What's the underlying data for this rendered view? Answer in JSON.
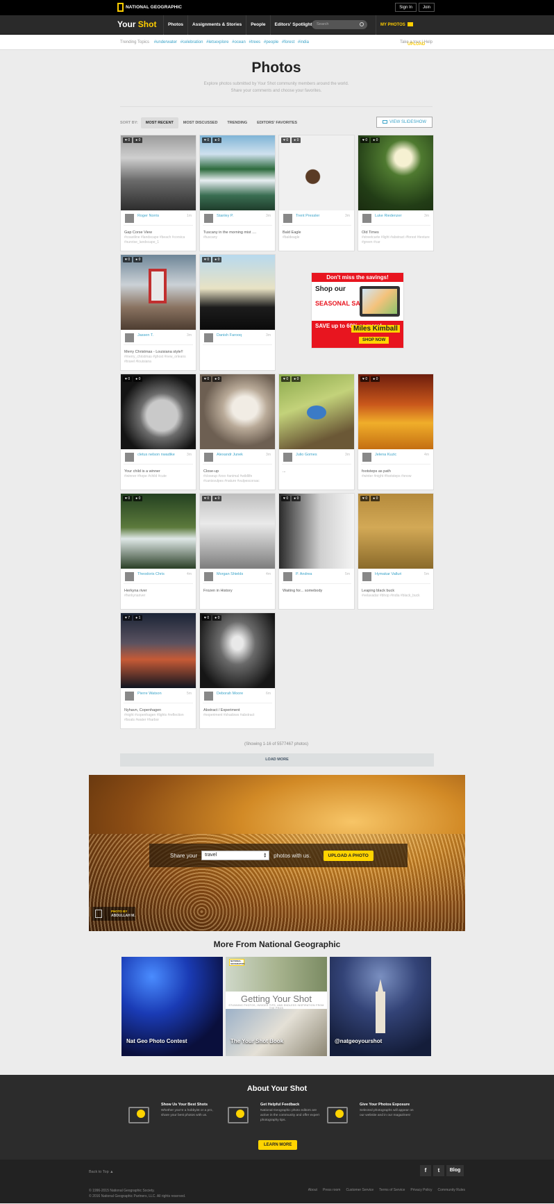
{
  "topbar": {
    "logo": "NATIONAL GEOGRAPHIC",
    "sign_in": "Sign In",
    "join": "Join"
  },
  "nav": {
    "brand_a": "Your",
    "brand_b": "Shot",
    "items": [
      "Photos",
      "Assignments & Stories",
      "People",
      "Editors' Spotlight"
    ],
    "search_placeholder": "Search",
    "my_photos": "MY PHOTOS",
    "upload": "UPLOAD"
  },
  "trending": {
    "label": "Trending Topics",
    "tags": [
      "#underwater",
      "#celebration",
      "#letsexplore",
      "#ocean",
      "#trees",
      "#people",
      "#forest",
      "#india"
    ],
    "take_tour": "Take a tour",
    "help": "Help"
  },
  "header": {
    "title": "Photos",
    "subtitle_1": "Explore photos submitted by Your Shot community members around the world.",
    "subtitle_2": "Share your comments and choose your favorites."
  },
  "sort": {
    "label": "SORT BY:",
    "options": [
      "MOST RECENT",
      "MOST DISCUSSED",
      "TRENDING",
      "EDITORS' FAVORITES"
    ],
    "slideshow": "VIEW SLIDESHOW"
  },
  "photos": [
    {
      "likes": "0",
      "comments": "0",
      "author": "Roger Norris",
      "age": "1m",
      "caption": "Gap Corse View",
      "tags": "#coastline #landscape #beach #corsica #sunrise_landscape_1"
    },
    {
      "likes": "0",
      "comments": "0",
      "author": "Stanley P.",
      "age": "3m",
      "caption": "Tuscany in the morning mist ....",
      "tags": "#tuscany"
    },
    {
      "likes": "0",
      "comments": "0",
      "author": "Trent Pressler",
      "age": "3m",
      "caption": "Bald Eagle",
      "tags": "#baldeagle"
    },
    {
      "likes": "0",
      "comments": "0",
      "author": "Luke Riedenzer",
      "age": "3m",
      "caption": "Old Times",
      "tags": "#streetcarte #light #abstract #forest #texture #green #car"
    },
    {
      "likes": "0",
      "comments": "0",
      "author": "Jassen T.",
      "age": "3m",
      "caption": "Merry Christmas - Louisiana style!!",
      "tags": "#merry_christmas #ghost #new_orleans #travel #louisiana"
    },
    {
      "likes": "0",
      "comments": "0",
      "author": "Danish Farooq",
      "age": "3m",
      "caption": "",
      "tags": ""
    },
    {
      "likes": "0",
      "comments": "0",
      "author": "cletus nelson nwadike",
      "age": "3m",
      "caption": "Your child is a winner",
      "tags": "#winner #hope #child #cute"
    },
    {
      "likes": "0",
      "comments": "0",
      "author": "Alexandr Junek",
      "age": "3m",
      "caption": "Close-up",
      "tags": "#closeup #zoo #animal #wildlife #canisvulpes #nature #vulpescorsac"
    },
    {
      "likes": "0",
      "comments": "0",
      "author": "Julio Gomes",
      "age": "3m",
      "caption": "...",
      "tags": ""
    },
    {
      "likes": "0",
      "comments": "0",
      "author": "Jelena Kuzic",
      "age": "4m",
      "caption": "footsteps as path",
      "tags": "#winter #night #footsteps #snow"
    },
    {
      "likes": "0",
      "comments": "0",
      "author": "Theodoris Chris",
      "age": "4m",
      "caption": "Herkyna river",
      "tags": "#herkynariver"
    },
    {
      "likes": "0",
      "comments": "0",
      "author": "Morgan Shields",
      "age": "4m",
      "caption": "Frozen in History",
      "tags": ""
    },
    {
      "likes": "0",
      "comments": "0",
      "author": "P. Andrea",
      "age": "5m",
      "caption": "Waiting for... somebody",
      "tags": ""
    },
    {
      "likes": "0",
      "comments": "0",
      "author": "Hymakar Valluri",
      "age": "5m",
      "caption": "Leaping black buck",
      "tags": "#velavadar #bhop #india #black_buck"
    },
    {
      "likes": "7",
      "comments": "1",
      "author": "Pierre Watson",
      "age": "5m",
      "caption": "Nyhavn, Copenhagen",
      "tags": "#night #copenhagen #lights #reflection #boats #water #harbor"
    },
    {
      "likes": "0",
      "comments": "0",
      "author": "Deborah Moore",
      "age": "6m",
      "caption": "Abstract / Experiment",
      "tags": "#experiment #shadows #abstract"
    }
  ],
  "ad": {
    "headline": "Don't miss the savings!",
    "line1": "Shop our",
    "line2": "SEASONAL SALE",
    "save": "SAVE up to 60% or more!",
    "brand": "Miles Kimball",
    "cta": "SHOP NOW"
  },
  "showing": "(Showing 1-16 of 5577467 photos)",
  "load_more": "LOAD MORE",
  "hero": {
    "share_prefix": "Share your",
    "select_value": "travel",
    "share_suffix": "photos with us.",
    "button": "UPLOAD A PHOTO",
    "credit_label": "PHOTO BY",
    "credit_name": "ABDULLAH M."
  },
  "more": {
    "title": "More From National Geographic",
    "cards": [
      "Nat Geo Photo Contest",
      "The Your Shot Book",
      "@natgeoyourshot"
    ],
    "book_title": "Getting Your Shot",
    "book_sub": "STUNNING PHOTOS, INSIDER TIPS, AND ENDLESS INSPIRATION FROM THE PROS",
    "book_logo": "NATIONAL GEOGRAPHIC"
  },
  "about": {
    "title": "About Your Shot",
    "cols": [
      {
        "title": "Show Us Your Best Shots",
        "text": "Whether you're a hobbyist or a pro, share your best photos with us."
      },
      {
        "title": "Get Helpful Feedback",
        "text": "National Geographic photo editors are active in the community and offer expert photography tips."
      },
      {
        "title": "Give Your Photos Exposure",
        "text": "Selected photographs will appear on our website and in our magazines!"
      }
    ],
    "learn_more": "LEARN MORE"
  },
  "footer": {
    "back_to_top": "Back to Top ▲",
    "social_fb": "f",
    "social_tw": "t",
    "social_blog": "Blog",
    "copy_1": "© 1996-2015 National Geographic Society.",
    "copy_2": "© 2016 National Geographic Partners, LLC. All rights reserved.",
    "links": [
      "About",
      "Press room",
      "Customer Service",
      "Terms of Service",
      "Privacy Policy",
      "Community Rules"
    ]
  }
}
